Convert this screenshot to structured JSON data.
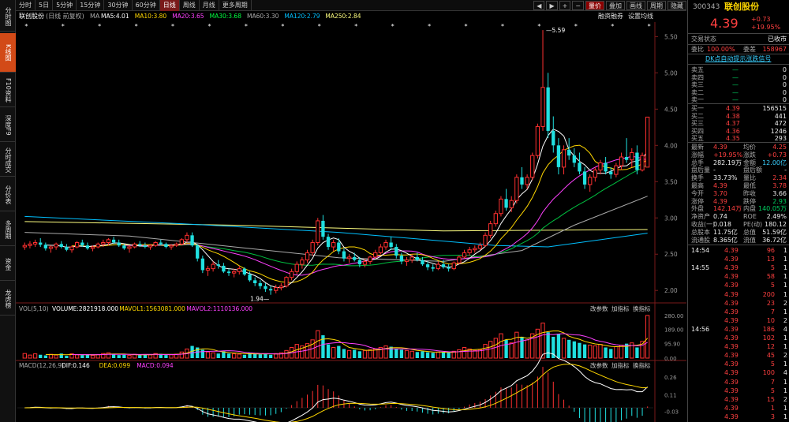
{
  "left_rail": [
    "分时图",
    "K线图",
    "F10资料",
    "深度F9",
    "分时成交",
    "分价表",
    "多周期",
    "资金",
    "龙虎榜"
  ],
  "period_bar": {
    "periods": [
      "分时",
      "5日",
      "5分钟",
      "15分钟",
      "30分钟",
      "60分钟",
      "日线",
      "周线",
      "月线",
      "更多周期"
    ],
    "active": "日线",
    "tools": [
      "量价",
      "叠加",
      "画线",
      "周期",
      "隐藏"
    ],
    "active_tool": "量价"
  },
  "chart_header": {
    "stock_label": "联创股份",
    "adjust": "(日线 前复权)",
    "ma_label": "MA",
    "ma": [
      {
        "text": "MA5:4.01",
        "color": "#ffffff"
      },
      {
        "text": "MA10:3.80",
        "color": "#ffd700"
      },
      {
        "text": "MA20:3.65",
        "color": "#ff40ff"
      },
      {
        "text": "MA30:3.68",
        "color": "#00ff40"
      },
      {
        "text": "MA60:3.30",
        "color": "#aaaaaa"
      },
      {
        "text": "MA120:2.79",
        "color": "#00c0ff"
      },
      {
        "text": "MA250:2.84",
        "color": "#ffff80"
      }
    ],
    "right_links": [
      "融资融券",
      "设置均线"
    ]
  },
  "volume_header": {
    "label": "VOL(5,10)",
    "items": [
      {
        "text": "VOLUME:2821918.000",
        "color": "#ffffff"
      },
      {
        "text": "MAVOL1:1563081.000",
        "color": "#ffd700"
      },
      {
        "text": "MAVOL2:1110136.000",
        "color": "#ff40ff"
      }
    ],
    "links": [
      "改参数",
      "加指标",
      "换指标"
    ]
  },
  "macd_header": {
    "label": "MACD(12,26,9)",
    "items": [
      {
        "text": "DIF:0.146",
        "color": "#ffffff"
      },
      {
        "text": "DEA:0.099",
        "color": "#ffd700"
      },
      {
        "text": "MACD:0.094",
        "color": "#ff40ff"
      }
    ],
    "links": [
      "改参数",
      "加指标",
      "换指标"
    ]
  },
  "annotations": {
    "high": "5.59",
    "low": "1.94"
  },
  "right_panel": {
    "code": "300343",
    "name": "联创股份",
    "price": "4.39",
    "change": "+0.73",
    "change_pct": "+19.95%",
    "status_label": "交易状态",
    "status_value": "已收市",
    "wei_bi_label": "委比",
    "wei_bi": "100.00%",
    "wei_cha_label": "委差",
    "wei_cha": "158967",
    "promo": "DK点自动提示涨跌信号",
    "sells": [
      {
        "label": "卖五",
        "price": "—",
        "vol": "0"
      },
      {
        "label": "卖四",
        "price": "—",
        "vol": "0"
      },
      {
        "label": "卖三",
        "price": "—",
        "vol": "0"
      },
      {
        "label": "卖二",
        "price": "—",
        "vol": "0"
      },
      {
        "label": "卖一",
        "price": "—",
        "vol": "0"
      }
    ],
    "buys": [
      {
        "label": "买一",
        "price": "4.39",
        "vol": "156515"
      },
      {
        "label": "买二",
        "price": "4.38",
        "vol": "441"
      },
      {
        "label": "买三",
        "price": "4.37",
        "vol": "472"
      },
      {
        "label": "买四",
        "price": "4.36",
        "vol": "1246"
      },
      {
        "label": "买五",
        "price": "4.35",
        "vol": "293"
      }
    ],
    "stats": [
      {
        "l1": "最新",
        "v1": "4.39",
        "c1": "red",
        "l2": "均价",
        "v2": "4.25",
        "c2": "red"
      },
      {
        "l1": "涨幅",
        "v1": "+19.95%",
        "c1": "red",
        "l2": "涨跌",
        "v2": "+0.73",
        "c2": "red"
      },
      {
        "l1": "总手",
        "v1": "282.19万",
        "c1": "white",
        "l2": "金额",
        "v2": "12.00亿",
        "c2": "cyan"
      },
      {
        "l1": "盘后量",
        "v1": "-",
        "c1": "white",
        "l2": "盘后额",
        "v2": "-",
        "c2": "white"
      },
      {
        "l1": "换手",
        "v1": "33.73%",
        "c1": "white",
        "l2": "量比",
        "v2": "2.34",
        "c2": "red"
      },
      {
        "l1": "最高",
        "v1": "4.39",
        "c1": "red",
        "l2": "最低",
        "v2": "3.78",
        "c2": "red"
      },
      {
        "l1": "今开",
        "v1": "3.70",
        "c1": "red",
        "l2": "昨收",
        "v2": "3.66",
        "c2": "white"
      },
      {
        "l1": "涨停",
        "v1": "4.39",
        "c1": "red",
        "l2": "跌停",
        "v2": "2.93",
        "c2": "green"
      },
      {
        "l1": "外盘",
        "v1": "142.14万",
        "c1": "red",
        "l2": "内盘",
        "v2": "140.05万",
        "c2": "green"
      },
      {
        "l1": "净资产",
        "v1": "0.74",
        "c1": "white",
        "l2": "ROE",
        "v2": "2.49%",
        "c2": "white"
      },
      {
        "l1": "收益(一)",
        "v1": "0.018",
        "c1": "white",
        "l2": "PE(动)",
        "v2": "180.12",
        "c2": "white"
      },
      {
        "l1": "总股本",
        "v1": "11.75亿",
        "c1": "white",
        "l2": "总值",
        "v2": "51.59亿",
        "c2": "white"
      },
      {
        "l1": "流通股",
        "v1": "8.365亿",
        "c1": "white",
        "l2": "流值",
        "v2": "36.72亿",
        "c2": "white"
      }
    ],
    "ticks": [
      {
        "t": "14:54",
        "p": "4.39",
        "v": "96",
        "n": "1"
      },
      {
        "t": "",
        "p": "4.39",
        "v": "13",
        "n": "1"
      },
      {
        "t": "14:55",
        "p": "4.39",
        "v": "5",
        "n": "1"
      },
      {
        "t": "",
        "p": "4.39",
        "v": "58",
        "n": "1"
      },
      {
        "t": "",
        "p": "4.39",
        "v": "5",
        "n": "1"
      },
      {
        "t": "",
        "p": "4.39",
        "v": "200",
        "n": "1"
      },
      {
        "t": "",
        "p": "4.39",
        "v": "23",
        "n": "2"
      },
      {
        "t": "",
        "p": "4.39",
        "v": "7",
        "n": "1"
      },
      {
        "t": "",
        "p": "4.39",
        "v": "10",
        "n": "2"
      },
      {
        "t": "14:56",
        "p": "4.39",
        "v": "186",
        "n": "4"
      },
      {
        "t": "",
        "p": "4.39",
        "v": "102",
        "n": "1"
      },
      {
        "t": "",
        "p": "4.39",
        "v": "12",
        "n": "1"
      },
      {
        "t": "",
        "p": "4.39",
        "v": "45",
        "n": "2"
      },
      {
        "t": "",
        "p": "4.39",
        "v": "5",
        "n": "1"
      },
      {
        "t": "",
        "p": "4.39",
        "v": "100",
        "n": "4"
      },
      {
        "t": "",
        "p": "4.39",
        "v": "7",
        "n": "1"
      },
      {
        "t": "",
        "p": "4.39",
        "v": "5",
        "n": "1"
      },
      {
        "t": "",
        "p": "4.39",
        "v": "15",
        "n": "2"
      },
      {
        "t": "",
        "p": "4.39",
        "v": "1",
        "n": "1"
      },
      {
        "t": "",
        "p": "4.39",
        "v": "3",
        "n": "1"
      }
    ]
  },
  "chart_data": {
    "type": "candlestick",
    "price_ticks": [
      "5.50",
      "5.00",
      "4.50",
      "4.00",
      "3.50",
      "3.00",
      "2.50",
      "2.00"
    ],
    "vol_ticks": [
      "280.00",
      "189.00",
      "95.90",
      "0.00"
    ],
    "macd_ticks": [
      "0.26",
      "0.11",
      "-0.03"
    ],
    "ohlc": [
      [
        2.6,
        2.66,
        2.56,
        2.62
      ],
      [
        2.62,
        2.68,
        2.58,
        2.64
      ],
      [
        2.64,
        2.7,
        2.6,
        2.66
      ],
      [
        2.66,
        2.72,
        2.6,
        2.63
      ],
      [
        2.63,
        2.66,
        2.55,
        2.58
      ],
      [
        2.58,
        2.62,
        2.52,
        2.6
      ],
      [
        2.6,
        2.66,
        2.56,
        2.64
      ],
      [
        2.64,
        2.68,
        2.58,
        2.6
      ],
      [
        2.6,
        2.64,
        2.54,
        2.56
      ],
      [
        2.56,
        2.62,
        2.52,
        2.6
      ],
      [
        2.6,
        2.68,
        2.58,
        2.66
      ],
      [
        2.66,
        2.7,
        2.6,
        2.62
      ],
      [
        2.62,
        2.66,
        2.56,
        2.58
      ],
      [
        2.58,
        2.62,
        2.54,
        2.6
      ],
      [
        2.6,
        2.66,
        2.58,
        2.64
      ],
      [
        2.64,
        2.7,
        2.6,
        2.66
      ],
      [
        2.66,
        2.72,
        2.62,
        2.7
      ],
      [
        2.7,
        2.74,
        2.64,
        2.66
      ],
      [
        2.66,
        2.7,
        2.6,
        2.62
      ],
      [
        2.62,
        2.64,
        2.56,
        2.58
      ],
      [
        2.58,
        2.62,
        2.52,
        2.6
      ],
      [
        2.6,
        2.66,
        2.58,
        2.64
      ],
      [
        2.64,
        2.68,
        2.6,
        2.62
      ],
      [
        2.62,
        2.66,
        2.58,
        2.6
      ],
      [
        2.6,
        2.64,
        2.56,
        2.62
      ],
      [
        2.62,
        2.68,
        2.6,
        2.66
      ],
      [
        2.66,
        2.7,
        2.62,
        2.64
      ],
      [
        2.64,
        2.66,
        2.58,
        2.6
      ],
      [
        2.6,
        2.64,
        2.56,
        2.62
      ],
      [
        2.62,
        2.66,
        2.6,
        2.64
      ],
      [
        2.64,
        2.72,
        2.62,
        2.7
      ],
      [
        2.7,
        2.8,
        2.66,
        2.76
      ],
      [
        2.76,
        2.8,
        2.6,
        2.62
      ],
      [
        2.62,
        2.64,
        2.4,
        2.44
      ],
      [
        2.44,
        2.48,
        2.24,
        2.28
      ],
      [
        2.28,
        2.34,
        2.2,
        2.3
      ],
      [
        2.3,
        2.4,
        2.26,
        2.36
      ],
      [
        2.36,
        2.42,
        2.3,
        2.34
      ],
      [
        2.34,
        2.38,
        2.24,
        2.26
      ],
      [
        2.26,
        2.3,
        2.2,
        2.24
      ],
      [
        2.24,
        2.3,
        2.18,
        2.26
      ],
      [
        2.26,
        2.34,
        2.22,
        2.3
      ],
      [
        2.3,
        2.32,
        2.2,
        2.22
      ],
      [
        2.22,
        2.26,
        2.12,
        2.14
      ],
      [
        2.14,
        2.18,
        2.06,
        2.1
      ],
      [
        2.1,
        2.14,
        2.02,
        2.06
      ],
      [
        2.06,
        2.1,
        1.98,
        2.02
      ],
      [
        2.02,
        2.06,
        1.94,
        2.0
      ],
      [
        2.0,
        2.08,
        1.96,
        2.04
      ],
      [
        2.04,
        2.1,
        2.0,
        2.06
      ],
      [
        2.06,
        2.2,
        2.04,
        2.18
      ],
      [
        2.18,
        2.3,
        2.14,
        2.26
      ],
      [
        2.26,
        2.4,
        2.22,
        2.36
      ],
      [
        2.36,
        2.46,
        2.3,
        2.42
      ],
      [
        2.42,
        2.56,
        2.38,
        2.52
      ],
      [
        2.52,
        2.7,
        2.48,
        2.66
      ],
      [
        2.66,
        3.0,
        2.62,
        2.96
      ],
      [
        2.96,
        3.04,
        2.7,
        2.74
      ],
      [
        2.74,
        2.78,
        2.56,
        2.6
      ],
      [
        2.6,
        2.7,
        2.54,
        2.66
      ],
      [
        2.66,
        2.72,
        2.5,
        2.54
      ],
      [
        2.54,
        2.58,
        2.4,
        2.44
      ],
      [
        2.44,
        2.5,
        2.38,
        2.46
      ],
      [
        2.46,
        2.52,
        2.4,
        2.42
      ],
      [
        2.42,
        2.46,
        2.32,
        2.36
      ],
      [
        2.36,
        2.44,
        2.32,
        2.4
      ],
      [
        2.4,
        2.48,
        2.36,
        2.46
      ],
      [
        2.46,
        2.56,
        2.44,
        2.52
      ],
      [
        2.52,
        2.64,
        2.5,
        2.6
      ],
      [
        2.6,
        2.7,
        2.56,
        2.66
      ],
      [
        2.66,
        2.74,
        2.56,
        2.6
      ],
      [
        2.6,
        2.64,
        2.44,
        2.48
      ],
      [
        2.48,
        2.52,
        2.36,
        2.4
      ],
      [
        2.4,
        2.46,
        2.34,
        2.42
      ],
      [
        2.42,
        2.5,
        2.38,
        2.46
      ],
      [
        2.46,
        2.52,
        2.4,
        2.42
      ],
      [
        2.42,
        2.46,
        2.34,
        2.36
      ],
      [
        2.36,
        2.4,
        2.28,
        2.32
      ],
      [
        2.32,
        2.36,
        2.26,
        2.3
      ],
      [
        2.3,
        2.4,
        2.28,
        2.36
      ],
      [
        2.36,
        2.42,
        2.3,
        2.32
      ],
      [
        2.32,
        2.36,
        2.26,
        2.3
      ],
      [
        2.3,
        2.4,
        2.28,
        2.38
      ],
      [
        2.38,
        2.48,
        2.36,
        2.46
      ],
      [
        2.46,
        2.56,
        2.44,
        2.52
      ],
      [
        2.52,
        2.6,
        2.48,
        2.56
      ],
      [
        2.56,
        2.62,
        2.52,
        2.58
      ],
      [
        2.58,
        2.66,
        2.56,
        2.62
      ],
      [
        2.62,
        2.8,
        2.6,
        2.76
      ],
      [
        2.76,
        2.96,
        2.72,
        2.92
      ],
      [
        2.92,
        3.1,
        2.88,
        3.06
      ],
      [
        3.06,
        3.3,
        3.02,
        3.26
      ],
      [
        3.26,
        3.4,
        3.1,
        3.14
      ],
      [
        3.14,
        3.3,
        3.08,
        3.24
      ],
      [
        3.24,
        3.6,
        3.2,
        3.56
      ],
      [
        3.56,
        3.7,
        3.4,
        3.46
      ],
      [
        3.46,
        3.6,
        3.4,
        3.56
      ],
      [
        3.56,
        3.9,
        3.52,
        3.86
      ],
      [
        3.86,
        4.3,
        3.82,
        4.26
      ],
      [
        4.26,
        5.59,
        4.2,
        4.8
      ],
      [
        4.8,
        5.0,
        4.1,
        4.2
      ],
      [
        4.2,
        4.4,
        3.9,
        4.0
      ],
      [
        4.0,
        4.1,
        3.6,
        3.7
      ],
      [
        3.7,
        4.0,
        3.6,
        3.94
      ],
      [
        3.94,
        4.1,
        3.8,
        3.86
      ],
      [
        3.86,
        3.96,
        3.7,
        3.76
      ],
      [
        3.76,
        3.9,
        3.6,
        3.64
      ],
      [
        3.64,
        3.7,
        3.4,
        3.46
      ],
      [
        3.46,
        3.6,
        3.36,
        3.56
      ],
      [
        3.56,
        3.7,
        3.5,
        3.66
      ],
      [
        3.66,
        3.8,
        3.6,
        3.76
      ],
      [
        3.76,
        3.84,
        3.6,
        3.64
      ],
      [
        3.64,
        3.7,
        3.54,
        3.6
      ],
      [
        3.6,
        3.76,
        3.56,
        3.72
      ],
      [
        3.72,
        3.9,
        3.66,
        3.84
      ],
      [
        3.84,
        4.1,
        3.76,
        3.8
      ],
      [
        3.8,
        3.96,
        3.7,
        3.9
      ],
      [
        3.9,
        4.0,
        3.6,
        3.66
      ],
      [
        3.66,
        3.9,
        3.64,
        3.86
      ],
      [
        3.7,
        4.39,
        3.78,
        4.39
      ]
    ],
    "volume": [
      30,
      20,
      28,
      22,
      18,
      25,
      20,
      30,
      15,
      28,
      22,
      20,
      26,
      18,
      24,
      30,
      35,
      28,
      20,
      22,
      18,
      25,
      20,
      24,
      22,
      30,
      28,
      20,
      22,
      26,
      40,
      60,
      80,
      70,
      55,
      40,
      35,
      30,
      45,
      30,
      28,
      26,
      22,
      35,
      30,
      25,
      28,
      22,
      30,
      35,
      50,
      70,
      90,
      80,
      95,
      120,
      180,
      150,
      90,
      70,
      80,
      60,
      50,
      55,
      45,
      50,
      55,
      60,
      70,
      80,
      75,
      60,
      55,
      50,
      45,
      40,
      45,
      38,
      35,
      40,
      38,
      36,
      45,
      55,
      70,
      60,
      50,
      55,
      90,
      110,
      130,
      160,
      120,
      100,
      170,
      140,
      120,
      160,
      190,
      230,
      170,
      140,
      160,
      130,
      120,
      110,
      100,
      90,
      85,
      80,
      90,
      70,
      60,
      75,
      85,
      95,
      100,
      70,
      110,
      280
    ],
    "ma_lines": {
      "MA250": [
        [
          0,
          2.95
        ],
        [
          40,
          2.9
        ],
        [
          80,
          2.82
        ],
        [
          120,
          2.84
        ]
      ],
      "MA120": [
        [
          0,
          3.02
        ],
        [
          30,
          2.92
        ],
        [
          60,
          2.8
        ],
        [
          90,
          2.62
        ],
        [
          100,
          2.6
        ],
        [
          120,
          2.79
        ]
      ],
      "MA60": [
        [
          0,
          2.8
        ],
        [
          20,
          2.75
        ],
        [
          40,
          2.6
        ],
        [
          60,
          2.45
        ],
        [
          80,
          2.4
        ],
        [
          95,
          2.55
        ],
        [
          105,
          2.9
        ],
        [
          120,
          3.3
        ]
      ]
    }
  }
}
